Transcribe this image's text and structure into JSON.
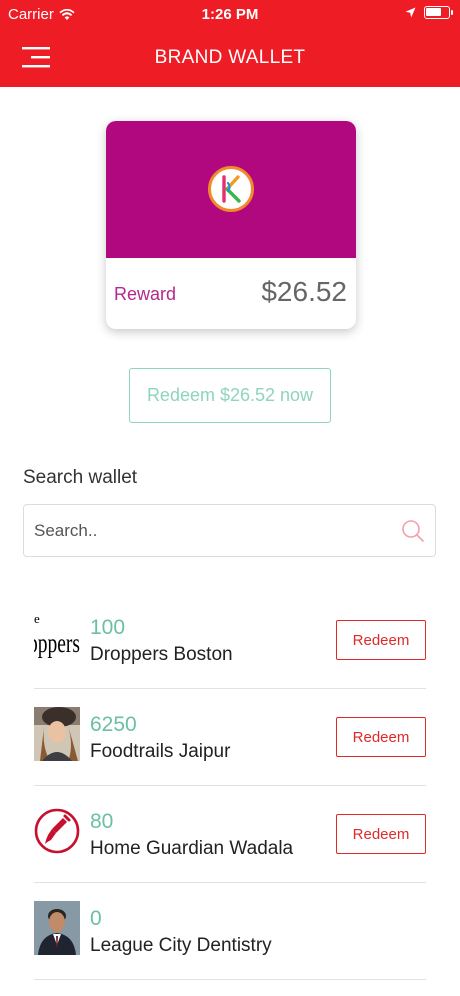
{
  "status_bar": {
    "carrier": "Carrier",
    "time": "1:26 PM",
    "battery_level": 0.7
  },
  "nav": {
    "title": "BRAND WALLET",
    "menu_icon": "menu-icon"
  },
  "card": {
    "logo_letter": "K",
    "label": "Reward",
    "amount": "$26.52",
    "color": "#b2087f"
  },
  "redeem_now": {
    "label": "Redeem $26.52 now"
  },
  "search": {
    "heading": "Search wallet",
    "placeholder": "Search..",
    "value": ""
  },
  "wallet_items": [
    {
      "points": "100",
      "name": "Droppers Boston",
      "thumb": "droppers-logo",
      "thumb_text": "e\npppers",
      "redeem": "Redeem"
    },
    {
      "points": "6250",
      "name": "Foodtrails Jaipur",
      "thumb": "person-photo",
      "redeem": "Redeem"
    },
    {
      "points": "80",
      "name": "Home Guardian Wadala",
      "thumb": "paintbrush-logo",
      "redeem": "Redeem"
    },
    {
      "points": "0",
      "name": "League City  Dentistry",
      "thumb": "person-photo",
      "redeem": ""
    }
  ],
  "colors": {
    "primary": "#ee1c25",
    "accent_green": "#6bbfa4",
    "card_magenta": "#b2087f"
  }
}
